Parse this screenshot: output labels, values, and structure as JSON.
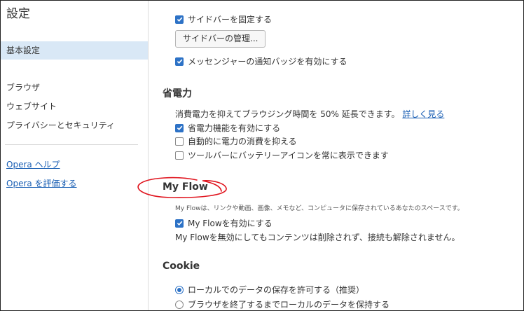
{
  "sidebar": {
    "title": "設定",
    "items": [
      {
        "label": "基本設定",
        "active": true
      },
      {
        "label": "ブラウザ"
      },
      {
        "label": "ウェブサイト"
      },
      {
        "label": "プライバシーとセキュリティ"
      }
    ],
    "links": [
      {
        "label": "Opera ヘルプ"
      },
      {
        "label": "Opera を評価する"
      }
    ]
  },
  "sidebar_section": {
    "pin_sidebar": {
      "label": "サイドバーを固定する",
      "checked": true
    },
    "manage_button": "サイドバーの管理...",
    "messenger_badges": {
      "label": "メッセンジャーの通知バッジを有効にする",
      "checked": true
    }
  },
  "battery": {
    "heading": "省電力",
    "description": "消費電力を抑えてブラウジング時間を 50% 延長できます。",
    "learn_more": "詳しく見る",
    "enable_saver": {
      "label": "省電力機能を有効にする",
      "checked": true
    },
    "auto_saver": {
      "label": "自動的に電力の消費を抑える",
      "checked": false
    },
    "toolbar_icon": {
      "label": "ツールバーにバッテリーアイコンを常に表示できます",
      "checked": false
    }
  },
  "myflow": {
    "heading": "My Flow",
    "description": "My Flowは、リンクや動画、画像、メモなど、コンピュータに保存されているあなたのスペースです。",
    "enable": {
      "label": "My Flowを有効にする",
      "checked": true
    },
    "note": "My Flowを無効にしてもコンテンツは削除されず、接続も解除されません。",
    "annotation_color": "#e0141e"
  },
  "cookie": {
    "heading": "Cookie",
    "options": [
      {
        "label": "ローカルでのデータの保存を許可する（推奨）",
        "selected": true
      },
      {
        "label": "ブラウザを終了するまでローカルのデータを保持する",
        "selected": false
      }
    ]
  },
  "colors": {
    "accent": "#2d72c6",
    "link": "#1a5fb4",
    "sidebar_active": "#d9e8f6"
  }
}
